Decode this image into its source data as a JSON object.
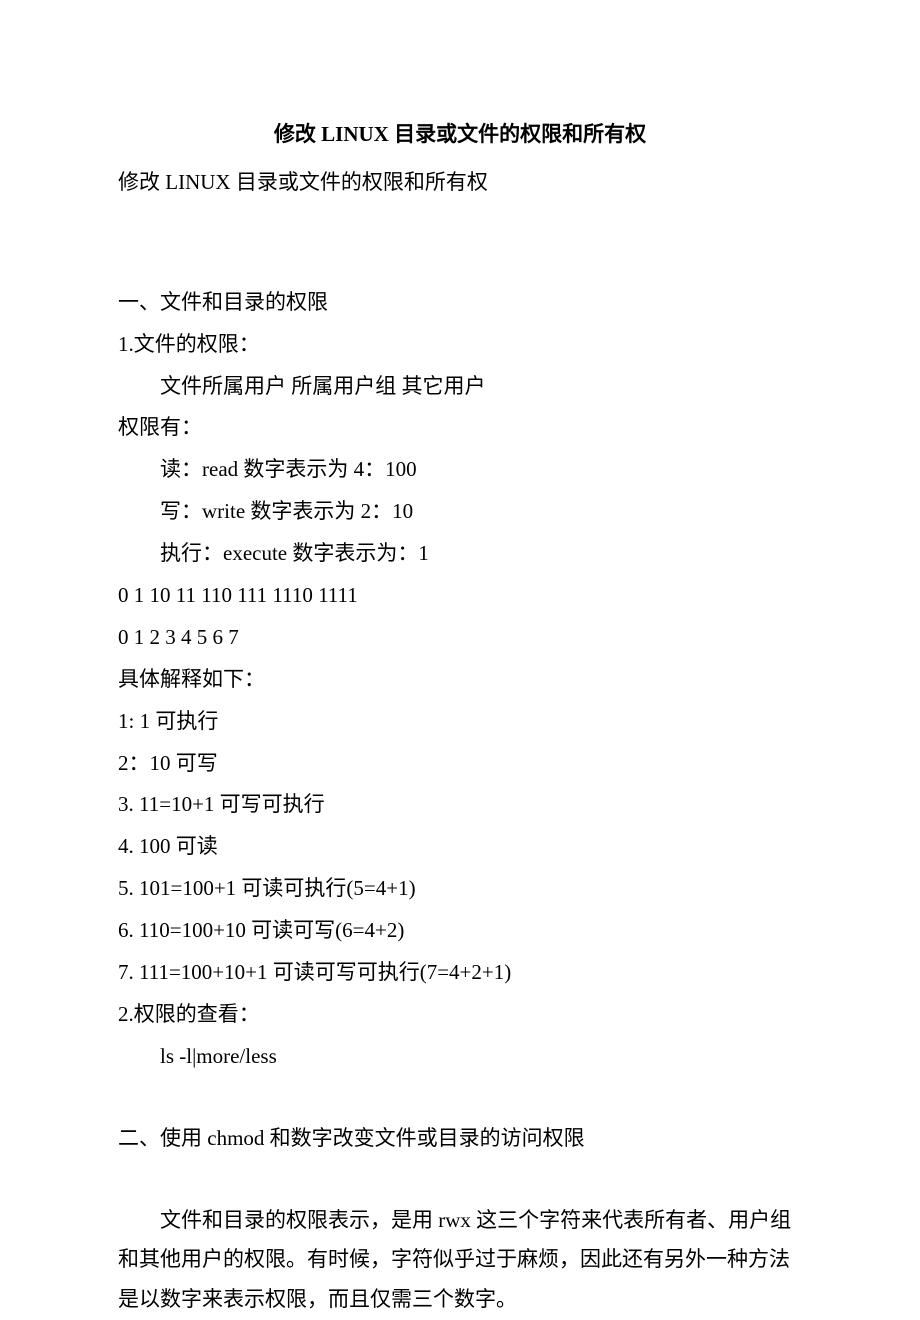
{
  "title": "修改 LINUX 目录或文件的权限和所有权",
  "subtitle": "修改 LINUX 目录或文件的权限和所有权",
  "section1": {
    "heading": "一、文件和目录的权限",
    "sub1": "1.文件的权限：",
    "line1": "文件所属用户   所属用户组  其它用户",
    "line2": "权限有：",
    "line3": "读：read    数字表示为 4：100",
    "line4": "写：write   数字表示为 2：10",
    "line5": "执行：execute  数字表示为：1",
    "line6": "0 1 10 11 110  111 1110 1111",
    "line7": "0 1  2  3   4    5    6    7",
    "line8": "具体解释如下：",
    "line9": "1: 1  可执行",
    "line10": "2：10 可写",
    "line11": "3. 11=10+1 可写可执行",
    "line12": "4. 100  可读",
    "line13": "5. 101=100+1 可读可执行(5=4+1)",
    "line14": "6. 110=100+10 可读可写(6=4+2)",
    "line15": "7. 111=100+10+1 可读可写可执行(7=4+2+1)",
    "sub2": "2.权限的查看：",
    "line16": "ls -l|more/less"
  },
  "section2": {
    "heading": "二、使用 chmod 和数字改变文件或目录的访问权限",
    "para": "　　文件和目录的权限表示，是用 rwx 这三个字符来代表所有者、用户组和其他用户的权限。有时候，字符似乎过于麻烦，因此还有另外一种方法是以数字来表示权限，而且仅需三个数字。"
  }
}
